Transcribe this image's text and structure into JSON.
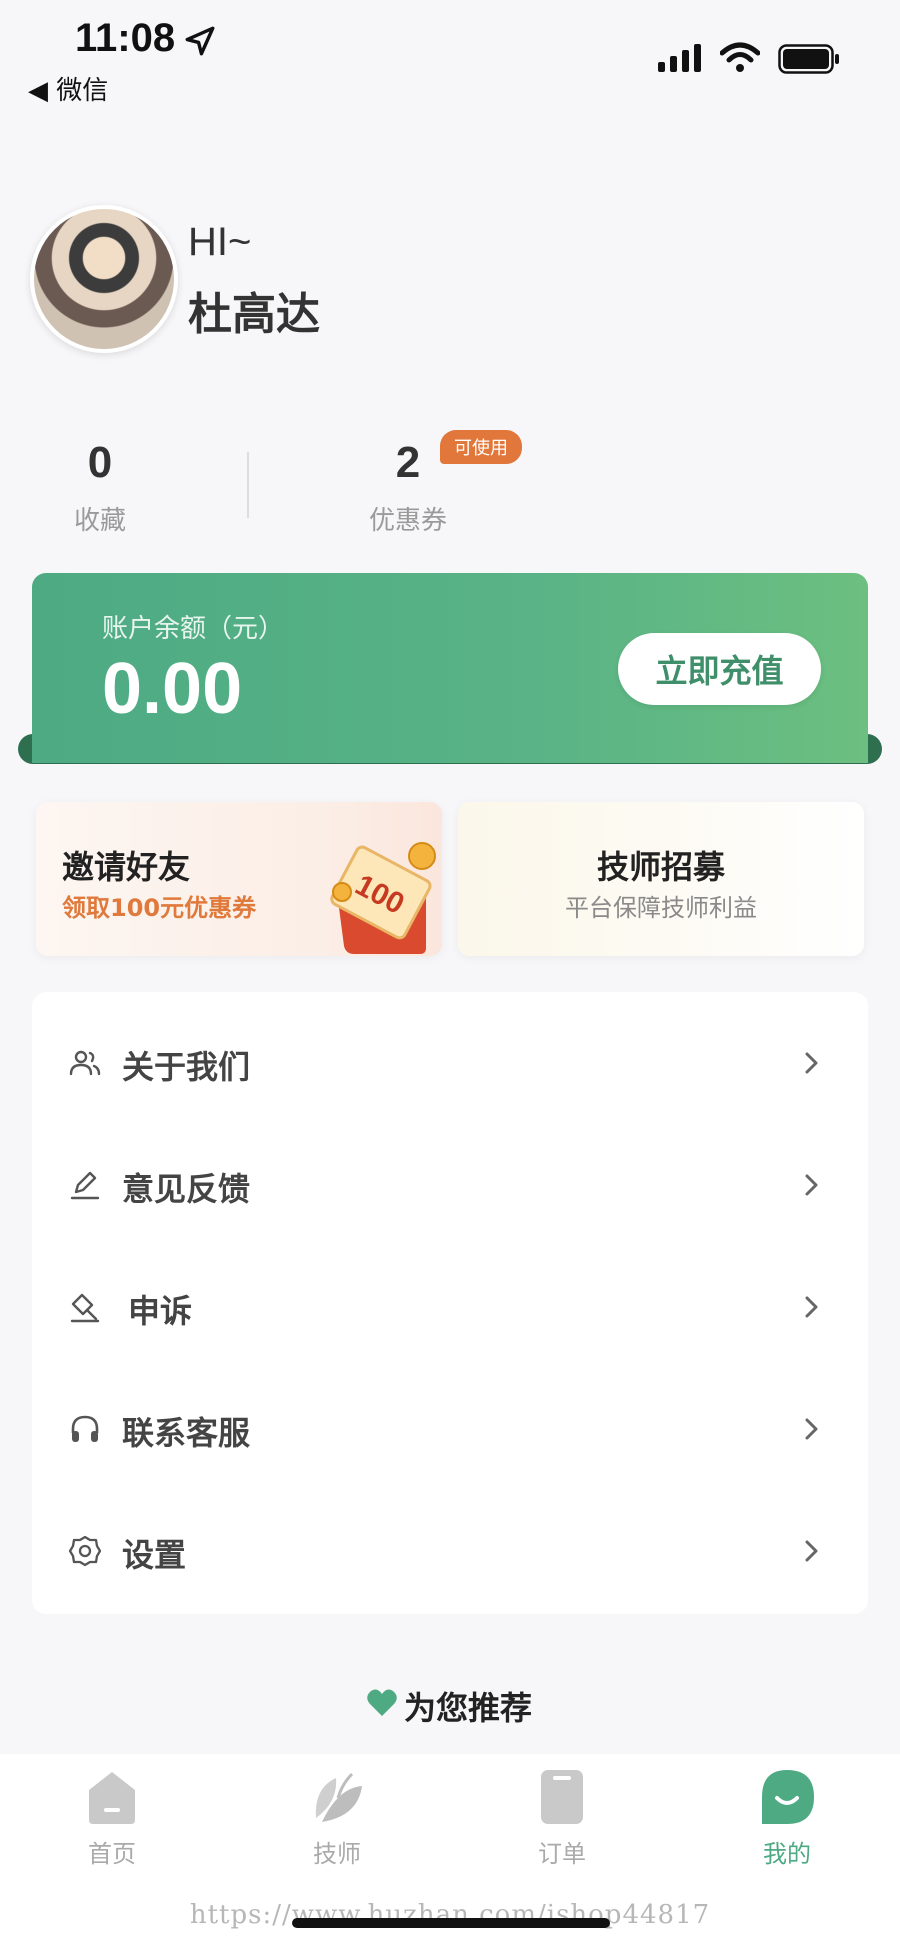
{
  "status_bar": {
    "time": "11:08",
    "back_label": "◀ 微信"
  },
  "profile": {
    "greeting": "HI~",
    "name": "杜高达"
  },
  "stats": {
    "favorites": {
      "value": "0",
      "label": "收藏"
    },
    "coupons": {
      "value": "2",
      "label": "优惠券",
      "badge": "可使用"
    }
  },
  "balance": {
    "label": "账户余额（元）",
    "value": "0.00",
    "recharge_label": "立即充值"
  },
  "promos": {
    "invite": {
      "title": "邀请好友",
      "subtitle": "领取100元优惠券",
      "coupon_art_text": "100"
    },
    "recruit": {
      "title": "技师招募",
      "subtitle": "平台保障技师利益"
    }
  },
  "menu": {
    "items": [
      {
        "label": "关于我们",
        "icon": "users-icon"
      },
      {
        "label": "意见反馈",
        "icon": "edit-icon"
      },
      {
        "label": "申诉",
        "icon": "gavel-icon"
      },
      {
        "label": "联系客服",
        "icon": "headset-icon"
      },
      {
        "label": "设置",
        "icon": "gear-icon"
      }
    ]
  },
  "recommend": {
    "title": "为您推荐"
  },
  "tabs": [
    {
      "label": "首页",
      "icon": "home-icon",
      "active": false
    },
    {
      "label": "技师",
      "icon": "leaf-icon",
      "active": false
    },
    {
      "label": "订单",
      "icon": "order-icon",
      "active": false
    },
    {
      "label": "我的",
      "icon": "smile-icon",
      "active": true
    }
  ],
  "watermark": "https://www.huzhan.com/ishop44817",
  "colors": {
    "accent": "#4daa83",
    "badge": "#e2773b",
    "invite_text": "#e07a3c"
  }
}
